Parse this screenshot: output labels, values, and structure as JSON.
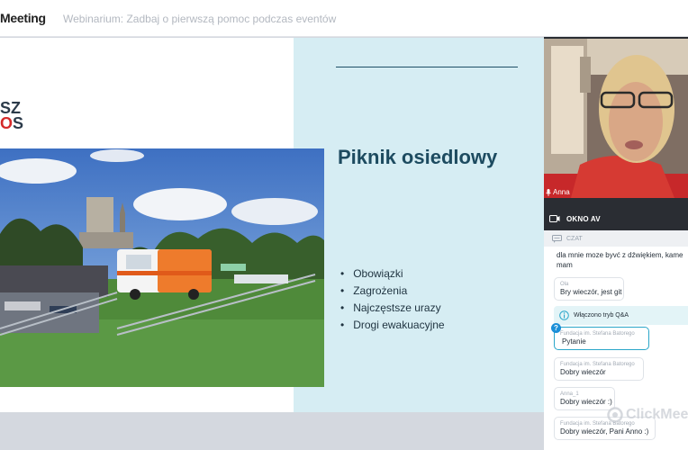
{
  "header": {
    "app_name": "Meeting",
    "webinar_title": "Webinarium: Zadbaj o pierwszą pomoc podczas eventów"
  },
  "slide": {
    "logo_line1": "SZ",
    "logo_line2": "S",
    "title": "Piknik osiedlowy",
    "bullets": [
      "Obowiązki",
      "Zagrożenia",
      "Najczęstsze urazy",
      "Drogi ewakuacyjne"
    ]
  },
  "video": {
    "participant_name": "Anna",
    "mic_icon": "microphone-icon"
  },
  "okno": {
    "label": "OKNO AV",
    "icon": "camera-icon"
  },
  "chat": {
    "header_label": "CZAT",
    "messages": [
      {
        "author": "",
        "text_line1": "dla mnie moze byvć z dźwiękiem, kame",
        "text_line2": "mam"
      },
      {
        "author": "Ola",
        "text": "Bry wieczór, jest git"
      },
      {
        "author": "Fundacja im. Stefana Batorego",
        "text": "Pytanie"
      },
      {
        "author": "Fundacja im. Stefana Batorego",
        "text": "Dobry wieczór"
      },
      {
        "author": "Anna_1",
        "text": "Dobry wieczór :)"
      },
      {
        "author": "Fundacja im. Stefana Batorego",
        "text": "Dobry wieczór, Pani Anno :)"
      }
    ],
    "qa_notice": "Włączono tryb Q&A",
    "q_badge": "?"
  },
  "watermark": "ClickMee",
  "colors": {
    "accent": "#2aa6c9",
    "panel_dark": "#2a2d33",
    "slide_accent": "#1d4b60"
  }
}
